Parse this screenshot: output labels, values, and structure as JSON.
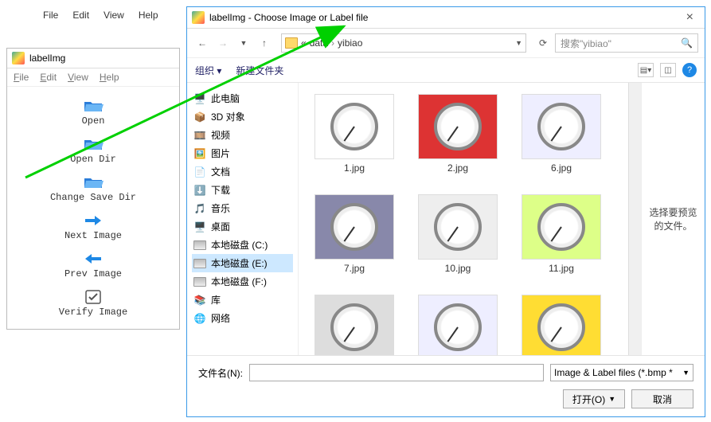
{
  "main_menu": {
    "file": "File",
    "edit": "Edit",
    "view": "View",
    "help": "Help"
  },
  "labelimg": {
    "title": "labelImg",
    "menu": {
      "file": "File",
      "edit": "Edit",
      "view": "View",
      "help": "Help"
    },
    "tools": {
      "open": "Open",
      "open_dir": "Open Dir",
      "change_save_dir": "Change Save Dir",
      "next_image": "Next Image",
      "prev_image": "Prev Image",
      "verify_image": "Verify Image"
    }
  },
  "dialog": {
    "title": "labelImg - Choose Image or Label file",
    "close": "×",
    "breadcrumb": {
      "root": "«",
      "p1": "data",
      "p2": "yibiao"
    },
    "search_placeholder": "搜索\"yibiao\"",
    "toolbar": {
      "organize": "组织 ▾",
      "newfolder": "新建文件夹"
    },
    "tree": [
      {
        "label": "此电脑",
        "icon": "pc"
      },
      {
        "label": "3D 对象",
        "icon": "3d"
      },
      {
        "label": "视频",
        "icon": "video"
      },
      {
        "label": "图片",
        "icon": "pictures"
      },
      {
        "label": "文档",
        "icon": "docs"
      },
      {
        "label": "下载",
        "icon": "downloads"
      },
      {
        "label": "音乐",
        "icon": "music"
      },
      {
        "label": "桌面",
        "icon": "desktop"
      },
      {
        "label": "本地磁盘 (C:)",
        "icon": "disk"
      },
      {
        "label": "本地磁盘 (E:)",
        "icon": "disk",
        "selected": true
      },
      {
        "label": "本地磁盘 (F:)",
        "icon": "disk"
      },
      {
        "label": "库",
        "icon": "lib"
      },
      {
        "label": "网络",
        "icon": "net"
      }
    ],
    "files": [
      {
        "name": "1.jpg"
      },
      {
        "name": "2.jpg"
      },
      {
        "name": "6.jpg"
      },
      {
        "name": "7.jpg"
      },
      {
        "name": "10.jpg"
      },
      {
        "name": "11.jpg"
      }
    ],
    "preview_text": "选择要预览的文件。",
    "filename_label": "文件名(N):",
    "filetype": "Image & Label files (*.bmp *",
    "open_btn": "打开(O)",
    "cancel_btn": "取消"
  }
}
